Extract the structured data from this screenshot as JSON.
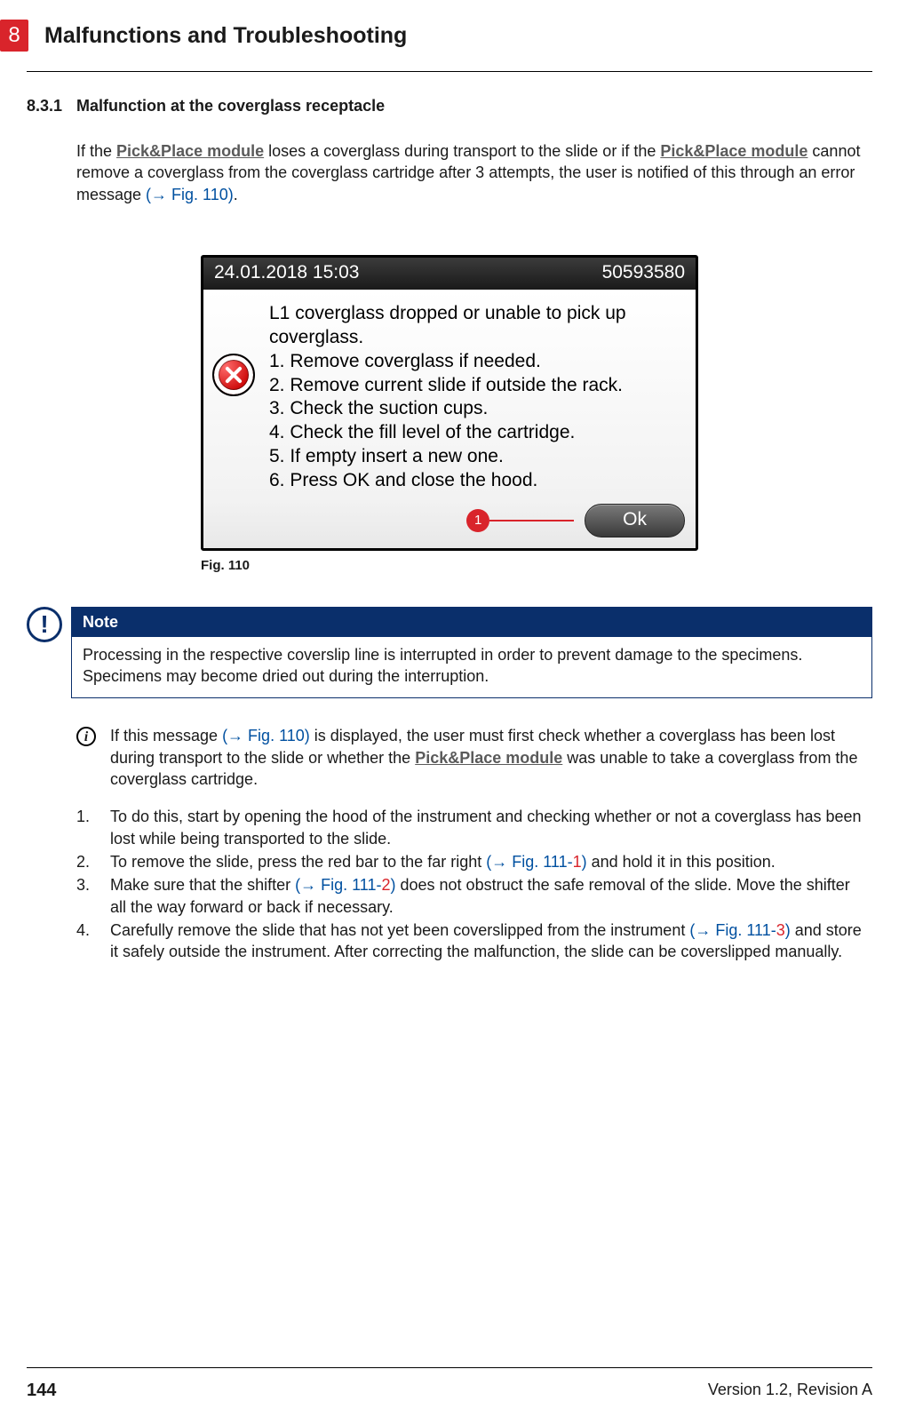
{
  "header": {
    "chapter_number": "8",
    "chapter_title": "Malfunctions and Troubleshooting"
  },
  "section": {
    "number": "8.3.1",
    "title": "Malfunction at the coverglass receptacle"
  },
  "intro": {
    "pre1": "If the ",
    "link1": "Pick&Place module",
    "mid1": " loses a coverglass during transport to the slide or if the ",
    "link2": "Pick&Place module",
    "mid2": " cannot remove a coverglass from the coverglass cartridge after 3 attempts, the user is notified of this through an error message ",
    "ref1": "(→ Fig. 110)",
    "tail": "."
  },
  "screenshot": {
    "timestamp": "24.01.2018 15:03",
    "code": "50593580",
    "msg_lines": [
      "L1 coverglass dropped or unable to pick up coverglass.",
      "1. Remove coverglass if needed.",
      "2. Remove current slide if outside the rack.",
      "3. Check the suction cups.",
      "4. Check the fill level of the cartridge.",
      "5. If empty insert a new one.",
      "6. Press OK and close the hood."
    ],
    "callout_label": "1",
    "ok_label": "Ok",
    "caption": "Fig. 110"
  },
  "note": {
    "title": "Note",
    "body": "Processing in the respective coverslip line is interrupted in order to prevent damage to the specimens. Specimens may become dried out during the interruption."
  },
  "info_para": {
    "pre": "If this message ",
    "ref": "(→ Fig. 110)",
    "mid": " is displayed, the user must first check whether a coverglass has been lost during transport to the slide or whether the ",
    "link": "Pick&Place module",
    "tail": " was unable to take a coverglass from the coverglass cartridge."
  },
  "steps": {
    "s1": "To do this, start by opening the hood of the instrument and checking whether or not a coverglass has been lost while being transported to the slide.",
    "s2_pre": "To remove the slide, press the red bar to the far right ",
    "s2_ref": "(→ Fig. 111",
    "s2_dash": "-",
    "s2_red": "1",
    "s2_close": ")",
    "s2_tail": " and hold it in this position.",
    "s3_pre": "Make sure that the shifter ",
    "s3_ref": "(→ Fig. 111",
    "s3_dash": "-",
    "s3_red": "2",
    "s3_close": ")",
    "s3_tail": " does not obstruct the safe removal of the slide. Move the shifter all the way forward or back if necessary.",
    "s4_pre": "Carefully remove the slide that has not yet been coverslipped from the instrument ",
    "s4_ref": "(→ Fig. 111",
    "s4_dash": "-",
    "s4_red": "3",
    "s4_close": ")",
    "s4_tail": " and store it safely outside the instrument. After correcting the malfunction, the slide can be coverslipped manually."
  },
  "footer": {
    "page": "144",
    "version": "Version 1.2, Revision A"
  }
}
